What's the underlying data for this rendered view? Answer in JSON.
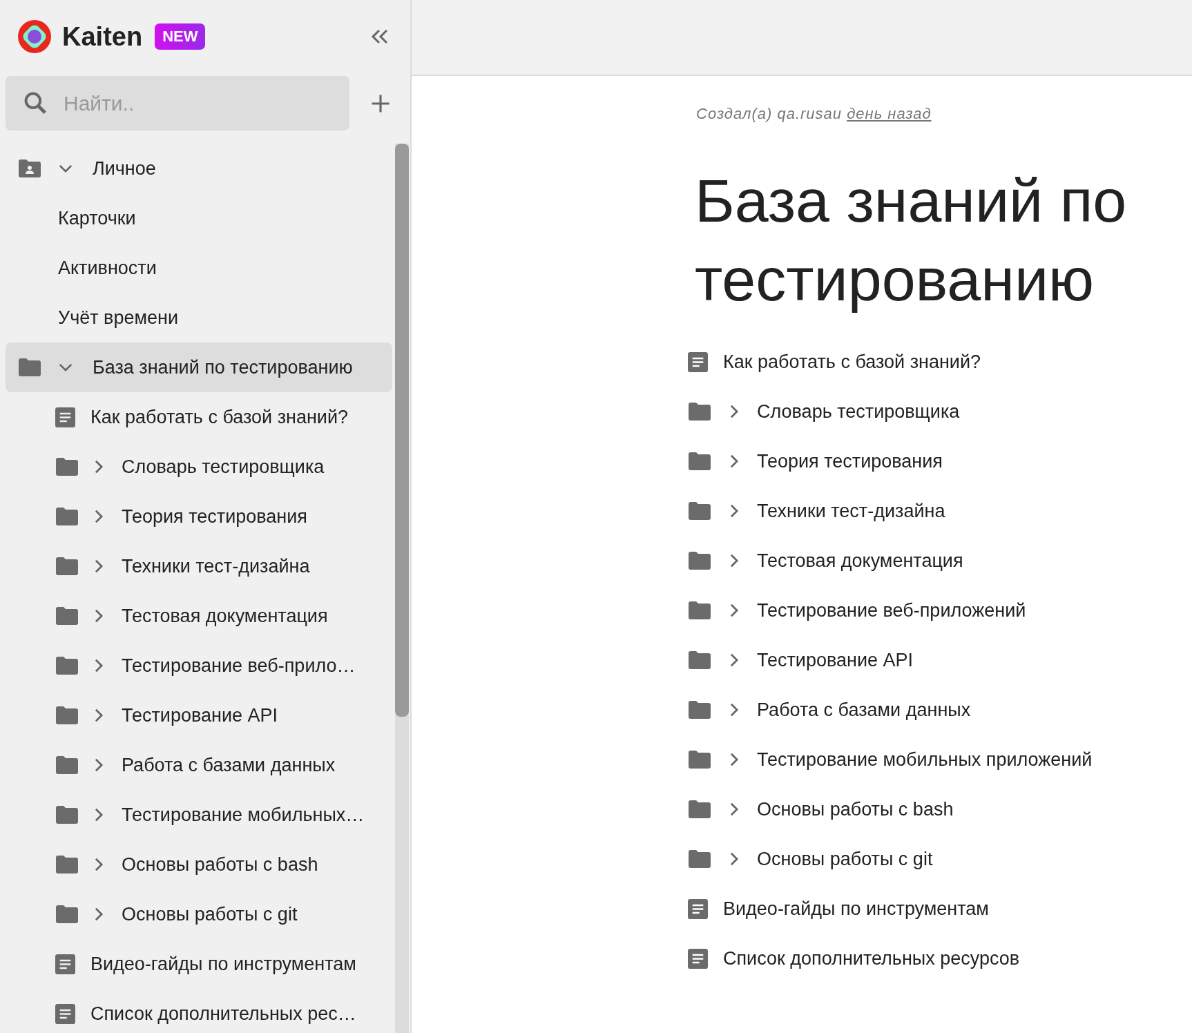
{
  "brand": {
    "name": "Kaiten",
    "badge": "NEW"
  },
  "search": {
    "placeholder": "Найти.."
  },
  "sidebar": {
    "sections": [
      {
        "kind": "personal",
        "label": "Личное",
        "expanded": true,
        "selected": false,
        "children": [
          {
            "kind": "page",
            "label": "Карточки"
          },
          {
            "kind": "page",
            "label": "Активности"
          },
          {
            "kind": "page",
            "label": "Учёт времени"
          }
        ]
      },
      {
        "kind": "folder",
        "label": "База знаний по тестированию",
        "expanded": true,
        "selected": true,
        "children": [
          {
            "kind": "doc",
            "label": "Как работать с базой знаний?"
          },
          {
            "kind": "folder",
            "label": "Словарь тестировщика",
            "expanded": false
          },
          {
            "kind": "folder",
            "label": "Теория тестирования",
            "expanded": false
          },
          {
            "kind": "folder",
            "label": "Техники тест-дизайна",
            "expanded": false
          },
          {
            "kind": "folder",
            "label": "Тестовая документация",
            "expanded": false
          },
          {
            "kind": "folder",
            "label": "Тестирование веб-прило…",
            "expanded": false
          },
          {
            "kind": "folder",
            "label": "Тестирование API",
            "expanded": false
          },
          {
            "kind": "folder",
            "label": "Работа с базами данных",
            "expanded": false
          },
          {
            "kind": "folder",
            "label": "Тестирование мобильных…",
            "expanded": false
          },
          {
            "kind": "folder",
            "label": "Основы работы с bash",
            "expanded": false
          },
          {
            "kind": "folder",
            "label": "Основы работы с git",
            "expanded": false
          },
          {
            "kind": "doc",
            "label": "Видео-гайды по инструментам"
          },
          {
            "kind": "doc",
            "label": "Список дополнительных рес…"
          }
        ]
      }
    ]
  },
  "page": {
    "meta": {
      "prefix": "Создал(а) qa.rusau",
      "link": "день назад"
    },
    "title": "База знаний по тестированию",
    "items": [
      {
        "kind": "doc",
        "label": "Как работать с базой знаний?"
      },
      {
        "kind": "folder",
        "label": "Словарь тестировщика",
        "expanded": false
      },
      {
        "kind": "folder",
        "label": "Теория тестирования",
        "expanded": false
      },
      {
        "kind": "folder",
        "label": "Техники тест-дизайна",
        "expanded": false
      },
      {
        "kind": "folder",
        "label": "Тестовая документация",
        "expanded": false
      },
      {
        "kind": "folder",
        "label": "Тестирование веб-приложений",
        "expanded": false
      },
      {
        "kind": "folder",
        "label": "Тестирование API",
        "expanded": false
      },
      {
        "kind": "folder",
        "label": "Работа с базами данных",
        "expanded": false
      },
      {
        "kind": "folder",
        "label": "Тестирование мобильных приложений",
        "expanded": false
      },
      {
        "kind": "folder",
        "label": "Основы работы с bash",
        "expanded": false
      },
      {
        "kind": "folder",
        "label": "Основы работы с git",
        "expanded": false
      },
      {
        "kind": "doc",
        "label": "Видео-гайды по инструментам"
      },
      {
        "kind": "doc",
        "label": "Список дополнительных ресурсов"
      }
    ]
  }
}
